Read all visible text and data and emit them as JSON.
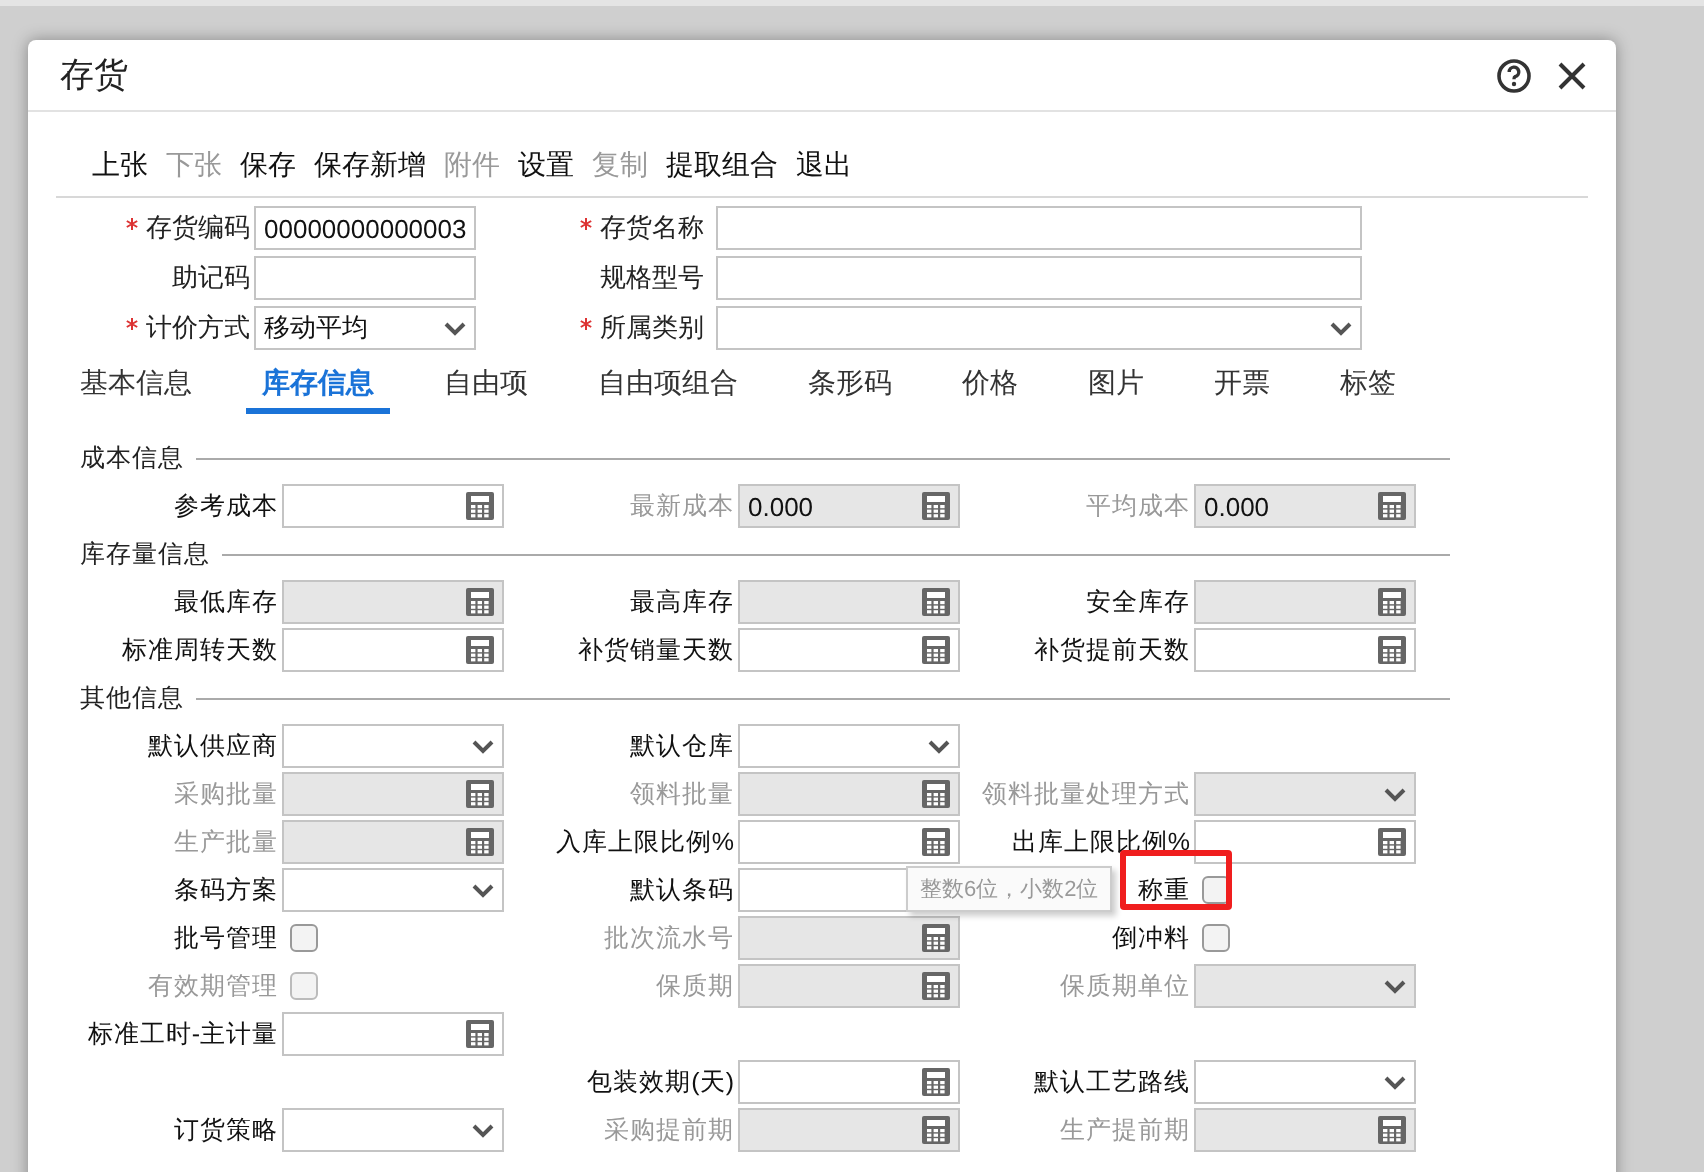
{
  "window": {
    "title": "存货"
  },
  "toolbar": [
    {
      "label": "上张",
      "disabled": false
    },
    {
      "label": "下张",
      "disabled": true
    },
    {
      "label": "保存",
      "disabled": false
    },
    {
      "label": "保存新增",
      "disabled": false
    },
    {
      "label": "附件",
      "disabled": true
    },
    {
      "label": "设置",
      "disabled": false
    },
    {
      "label": "复制",
      "disabled": true
    },
    {
      "label": "提取组合",
      "disabled": false
    },
    {
      "label": "退出",
      "disabled": false
    }
  ],
  "header_fields": [
    {
      "label": "存货编码",
      "required": true,
      "kind": "text",
      "value": "00000000000003"
    },
    {
      "label": "存货名称",
      "required": true,
      "kind": "text"
    },
    {
      "label": "助记码",
      "required": false,
      "kind": "text"
    },
    {
      "label": "规格型号",
      "required": false,
      "kind": "text"
    },
    {
      "label": "计价方式",
      "required": true,
      "kind": "select",
      "value": "移动平均"
    },
    {
      "label": "所属类别",
      "required": true,
      "kind": "select"
    }
  ],
  "tabs": [
    {
      "label": "基本信息",
      "selected": false
    },
    {
      "label": "库存信息",
      "selected": true
    },
    {
      "label": "自由项",
      "selected": false
    },
    {
      "label": "自由项组合",
      "selected": false
    },
    {
      "label": "条形码",
      "selected": false
    },
    {
      "label": "价格",
      "selected": false
    },
    {
      "label": "图片",
      "selected": false
    },
    {
      "label": "开票",
      "selected": false
    },
    {
      "label": "标签",
      "selected": false
    }
  ],
  "sections": [
    {
      "title": "成本信息",
      "rows": [
        {
          "left": {
            "label": "参考成本",
            "kind": "number",
            "disabled": false,
            "label_greyed": false
          },
          "middle": {
            "label": "最新成本",
            "kind": "number",
            "value": "0.000",
            "disabled": true,
            "label_greyed": true
          },
          "right": {
            "label": "平均成本",
            "kind": "number",
            "value": "0.000",
            "disabled": true,
            "label_greyed": true
          }
        }
      ]
    },
    {
      "title": "库存量信息",
      "rows": [
        {
          "left": {
            "label": "最低库存",
            "kind": "number",
            "disabled": true,
            "label_greyed": false
          },
          "middle": {
            "label": "最高库存",
            "kind": "number",
            "disabled": true,
            "label_greyed": false
          },
          "right": {
            "label": "安全库存",
            "kind": "number",
            "disabled": true,
            "label_greyed": false
          }
        },
        {
          "left": {
            "label": "标准周转天数",
            "kind": "number",
            "disabled": false,
            "label_greyed": false
          },
          "middle": {
            "label": "补货销量天数",
            "kind": "number",
            "disabled": false,
            "label_greyed": false
          },
          "right": {
            "label": "补货提前天数",
            "kind": "number",
            "disabled": false,
            "label_greyed": false
          }
        }
      ]
    },
    {
      "title": "其他信息",
      "rows": [
        {
          "left": {
            "label": "默认供应商",
            "kind": "select",
            "disabled": false,
            "label_greyed": false
          },
          "middle": {
            "label": "默认仓库",
            "kind": "select",
            "disabled": false,
            "label_greyed": false
          }
        },
        {
          "left": {
            "label": "采购批量",
            "kind": "number",
            "disabled": true,
            "label_greyed": true
          },
          "middle": {
            "label": "领料批量",
            "kind": "number",
            "disabled": true,
            "label_greyed": true
          },
          "right": {
            "label": "领料批量处理方式",
            "kind": "select",
            "disabled": true,
            "label_greyed": true
          }
        },
        {
          "left": {
            "label": "生产批量",
            "kind": "number",
            "disabled": true,
            "label_greyed": true
          },
          "middle": {
            "label": "入库上限比例%",
            "kind": "number",
            "disabled": false,
            "label_greyed": false
          },
          "right": {
            "label": "出库上限比例%",
            "kind": "number",
            "disabled": false,
            "label_greyed": false
          }
        },
        {
          "left": {
            "label": "条码方案",
            "kind": "select",
            "disabled": false,
            "label_greyed": false
          },
          "middle": {
            "label": "默认条码",
            "kind": "text",
            "disabled": false,
            "label_greyed": false
          },
          "right": {
            "label": "称重",
            "kind": "checkbox",
            "checked": false,
            "highlighted": true,
            "disabled": false,
            "label_greyed": false
          }
        },
        {
          "left": {
            "label": "批号管理",
            "kind": "checkbox",
            "checked": false,
            "highlighted": false,
            "disabled": false,
            "label_greyed": false
          },
          "middle": {
            "label": "批次流水号",
            "kind": "number",
            "disabled": true,
            "label_greyed": true
          },
          "right": {
            "label": "倒冲料",
            "kind": "checkbox",
            "checked": false,
            "highlighted": false,
            "disabled": false,
            "label_greyed": false
          }
        },
        {
          "left": {
            "label": "有效期管理",
            "kind": "checkbox",
            "checked": false,
            "highlighted": false,
            "disabled": true,
            "label_greyed": true
          },
          "middle": {
            "label": "保质期",
            "kind": "number",
            "disabled": true,
            "label_greyed": true
          },
          "right": {
            "label": "保质期单位",
            "kind": "select",
            "disabled": true,
            "label_greyed": true
          }
        },
        {
          "left": {
            "label": "标准工时-主计量",
            "kind": "number",
            "disabled": false,
            "label_greyed": false
          }
        },
        {
          "middle": {
            "label": "包装效期(天)",
            "kind": "number",
            "disabled": false,
            "label_greyed": false
          },
          "right": {
            "label": "默认工艺路线",
            "kind": "select",
            "disabled": false,
            "label_greyed": false
          }
        },
        {
          "left": {
            "label": "订货策略",
            "kind": "select",
            "disabled": false,
            "label_greyed": false
          },
          "middle": {
            "label": "采购提前期",
            "kind": "number",
            "disabled": true,
            "label_greyed": true
          },
          "right": {
            "label": "生产提前期",
            "kind": "number",
            "disabled": true,
            "label_greyed": true
          }
        }
      ]
    }
  ],
  "tooltip": "整数6位，小数2位"
}
